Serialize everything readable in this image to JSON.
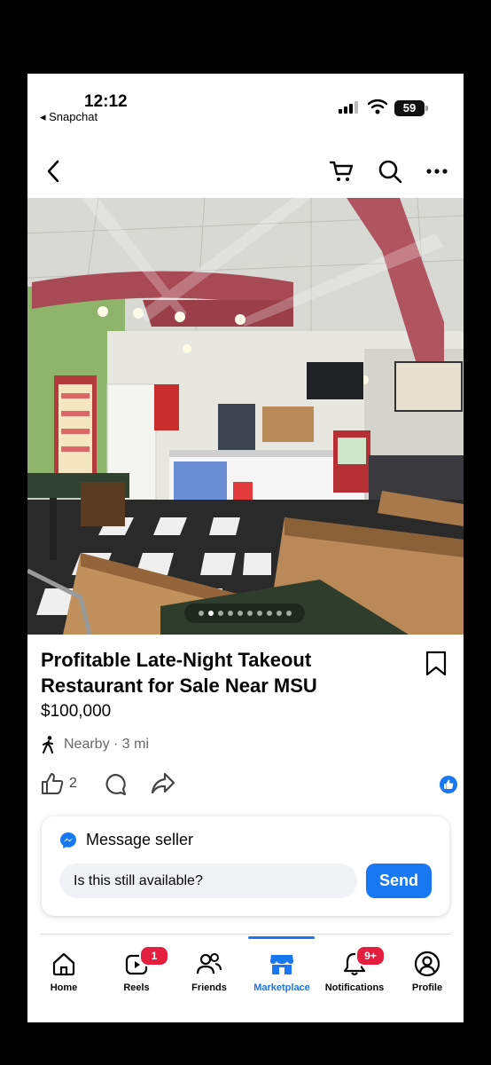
{
  "status_bar": {
    "time": "12:12",
    "back_app": "◂ Snapchat",
    "battery": "59"
  },
  "nav": {
    "back_icon": "chevron-left-icon",
    "cart_icon": "cart-icon",
    "search_icon": "search-icon",
    "more_icon": "more-horizontal-icon"
  },
  "carousel": {
    "total_images": 10,
    "active_index": 1
  },
  "listing": {
    "title": "Profitable Late-Night Takeout Restaurant for Sale Near MSU",
    "price": "$100,000",
    "location": "Nearby · 3 mi",
    "likes": "2"
  },
  "message": {
    "header": "Message seller",
    "input_value": "Is this still available?",
    "send_label": "Send"
  },
  "tabs": [
    {
      "label": "Home",
      "icon": "home-icon"
    },
    {
      "label": "Reels",
      "icon": "reels-icon",
      "badge": "1"
    },
    {
      "label": "Friends",
      "icon": "friends-icon"
    },
    {
      "label": "Marketplace",
      "icon": "marketplace-icon",
      "active": true
    },
    {
      "label": "Notifications",
      "icon": "bell-icon",
      "badge": "9+"
    },
    {
      "label": "Profile",
      "icon": "profile-icon"
    }
  ],
  "colors": {
    "accent": "#1877f2",
    "badge": "#e41e3f",
    "text": "#050505"
  }
}
